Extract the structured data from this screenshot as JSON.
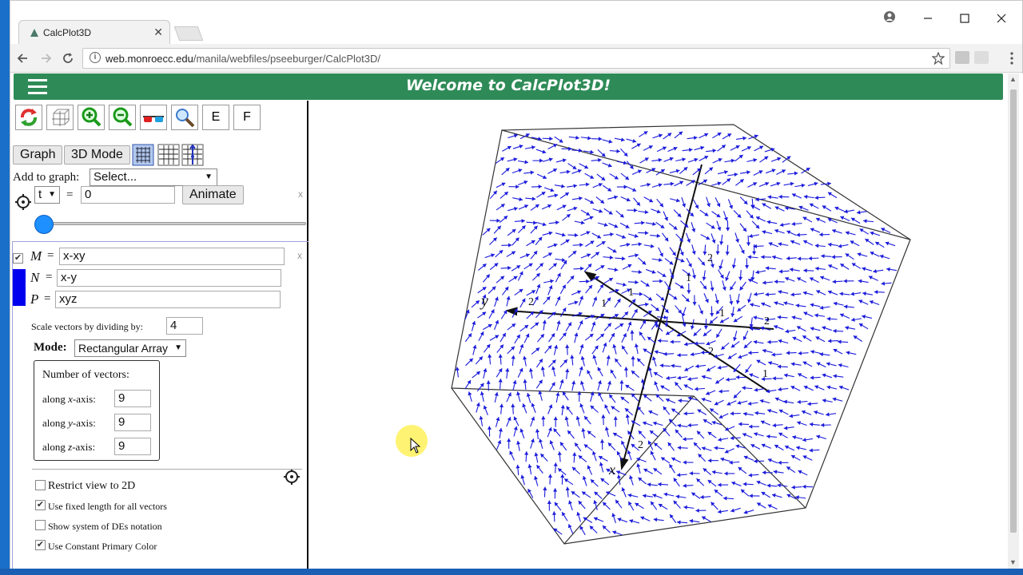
{
  "browser": {
    "tab_title": "CalcPlot3D",
    "tab_close": "✕",
    "url_host": "web.monroecc.edu",
    "url_path": "/manila/webfiles/pseeburger/CalcPlot3D/"
  },
  "header": {
    "title": "Welcome to CalcPlot3D!"
  },
  "toolbar": {
    "e_label": "E",
    "f_label": "F"
  },
  "controls": {
    "graph_label": "Graph",
    "mode3d_label": "3D Mode",
    "add_to_graph_label": "Add to graph:",
    "add_to_graph_value": "Select...",
    "param_name": "t",
    "equals": "=",
    "param_value": "0",
    "animate_label": "Animate",
    "close_x": "x",
    "slider_fraction": 0
  },
  "vector_field": {
    "m_label": "M",
    "m_value": "x-xy",
    "n_label": "N",
    "n_value": "x-y",
    "p_label": "P",
    "p_value": "xyz",
    "eq": "=",
    "color": "#0000ee",
    "scale_label": "Scale vectors by dividing by:",
    "scale_value": "4",
    "mode_label": "Mode:",
    "mode_value": "Rectangular Array",
    "num_vectors_label": "Number of vectors:",
    "along_x_pre": "along",
    "along_x_var": "x",
    "along_x_post": "-axis:",
    "along_x_value": "9",
    "along_y_var": "y",
    "along_y_value": "9",
    "along_z_var": "z",
    "along_z_value": "9",
    "restrict_2d_label": "Restrict view to 2D",
    "fixed_length_label": "Use fixed length for all vectors",
    "system_des_label": "Show system of DEs notation",
    "constant_color_label": "Use Constant Primary Color",
    "restrict_2d_checked": false,
    "fixed_length_checked": true,
    "system_des_checked": false,
    "constant_color_checked": true
  },
  "plot": {
    "axis_y_label": "y",
    "axis_x_label": "x",
    "tick_labels": [
      "2",
      "1",
      "1",
      "1",
      "2",
      "1",
      "2",
      "2",
      "1",
      "2"
    ],
    "vector_color": "#1a1adc"
  },
  "icons": {
    "reset": "rotate-arrows-icon",
    "box": "box-axes-icon",
    "zoom_in": "zoom-in-icon",
    "zoom_out": "zoom-out-icon",
    "glasses": "3d-glasses-icon",
    "magnifier": "magnifier-icon",
    "gear": "gear-icon"
  },
  "colors": {
    "header_bg": "#2e8b57",
    "accent_blue": "#1e90ff"
  }
}
